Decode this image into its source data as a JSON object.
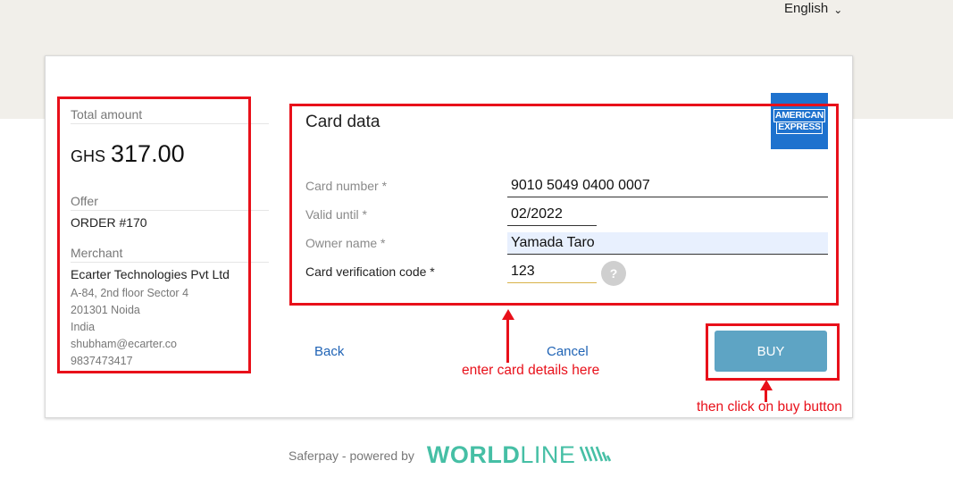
{
  "language": {
    "label": "English"
  },
  "summary": {
    "total_label": "Total amount",
    "currency": "GHS",
    "amount": "317.00",
    "offer_label": "Offer",
    "offer_value": "ORDER #170",
    "merchant_label": "Merchant",
    "merchant_name": "Ecarter Technologies Pvt Ltd",
    "merchant_lines": [
      "A-84, 2nd floor Sector 4",
      "201301 Noida",
      "India",
      "shubham@ecarter.co",
      "9837473417"
    ]
  },
  "form": {
    "title": "Card data",
    "card_brand": {
      "line1": "AMERICAN",
      "line2": "EXPRESS",
      "color": "#1e72ce"
    },
    "card_number_label": "Card number *",
    "card_number_value": "9010 5049 0400 0007",
    "valid_until_label": "Valid until *",
    "valid_until_value": "02/2022",
    "owner_label": "Owner name *",
    "owner_value": "Yamada Taro",
    "cvc_label": "Card verification code *",
    "cvc_value": "123",
    "help": "?"
  },
  "actions": {
    "back": "Back",
    "cancel": "Cancel",
    "buy": "BUY"
  },
  "annotations": {
    "enter_details": "enter card details here",
    "click_buy": "then click on buy button",
    "color": "#e8101a"
  },
  "footer": {
    "powered": "Saferpay - powered by",
    "brand_bold": "WORLD",
    "brand_light": "LINE"
  }
}
